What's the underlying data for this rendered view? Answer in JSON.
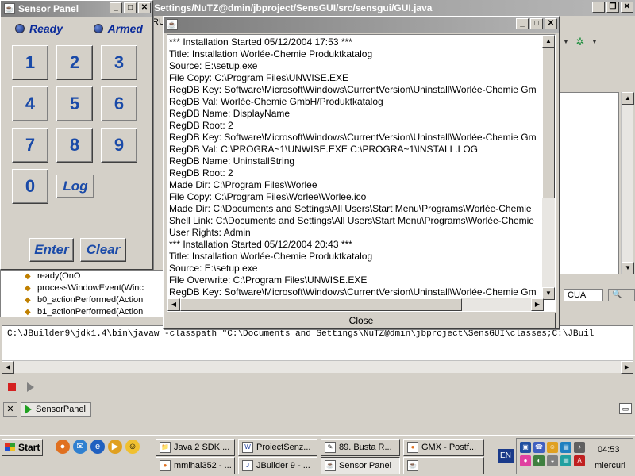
{
  "ide": {
    "title": "Settings/NuTZ@dmin/jbproject/SensGUI/src/sensgui/GUI.java",
    "structure_items": [
      "ready(OnO",
      "processWindowEvent(Winc",
      "b0_actionPerformed(Action",
      "b1_actionPerformed(Action"
    ],
    "command_line": "C:\\JBuilder9\\jdk1.4\\bin\\javaw -classpath \"C:\\Documents and Settings\\NuTZ@dmin\\jbproject\\SensGUI\\classes;C:\\JBuil",
    "run_tab_label": "SensorPanel",
    "status_select": "CUA",
    "toolbar_label": "RU"
  },
  "sensor_panel": {
    "title": "Sensor Panel",
    "indicators": [
      {
        "label": "Ready"
      },
      {
        "label": "Armed"
      }
    ],
    "keys": [
      "1",
      "2",
      "3",
      "4",
      "5",
      "6",
      "7",
      "8",
      "9",
      "0"
    ],
    "log_label": "Log",
    "enter_label": "Enter",
    "clear_label": "Clear"
  },
  "log_window": {
    "lines": [
      "***  Installation Started 05/12/2004 17:53  ***",
      "Title:  Installation Worlée-Chemie Produktkatalog",
      "Source: E:\\setup.exe",
      "File Copy: C:\\Program Files\\UNWISE.EXE",
      "RegDB Key: Software\\Microsoft\\Windows\\CurrentVersion\\Uninstall\\Worlée-Chemie Gm",
      "RegDB Val: Worlée-Chemie GmbH/Produktkatalog",
      "RegDB Name: DisplayName",
      "RegDB Root: 2",
      "RegDB Key: Software\\Microsoft\\Windows\\CurrentVersion\\Uninstall\\Worlée-Chemie Gm",
      "RegDB Val: C:\\PROGRA~1\\UNWISE.EXE C:\\PROGRA~1\\INSTALL.LOG",
      "RegDB Name: UninstallString",
      "RegDB Root: 2",
      "Made Dir: C:\\Program Files\\Worlee",
      "File Copy: C:\\Program Files\\Worlee\\Worlee.ico",
      "Made Dir: C:\\Documents and Settings\\All Users\\Start Menu\\Programs\\Worlée-Chemie",
      "Shell Link: C:\\Documents and Settings\\All Users\\Start Menu\\Programs\\Worlée-Chemie",
      "User Rights: Admin",
      "***  Installation Started 05/12/2004 20:43  ***",
      "Title:  Installation Worlée-Chemie Produktkatalog",
      "Source: E:\\setup.exe",
      "File Overwrite: C:\\Program Files\\UNWISE.EXE",
      "RegDB Key: Software\\Microsoft\\Windows\\CurrentVersion\\Uninstall\\Worlée-Chemie Gm"
    ],
    "close_label": "Close"
  },
  "taskbar": {
    "start_label": "Start",
    "tasks_row1": [
      "Java 2 SDK ...",
      "ProiectSenz...",
      "89. Busta R...",
      "GMX - Postf..."
    ],
    "tasks_row2": [
      "mmihai352 - ...",
      "JBuilder 9 - ...",
      "Sensor Panel"
    ],
    "language": "EN",
    "clock": "04:53",
    "day": "miercuri"
  },
  "colors": {
    "accent_blue": "#1a4aa8",
    "led_blue": "#102a7a",
    "stop_red": "#d42020"
  }
}
